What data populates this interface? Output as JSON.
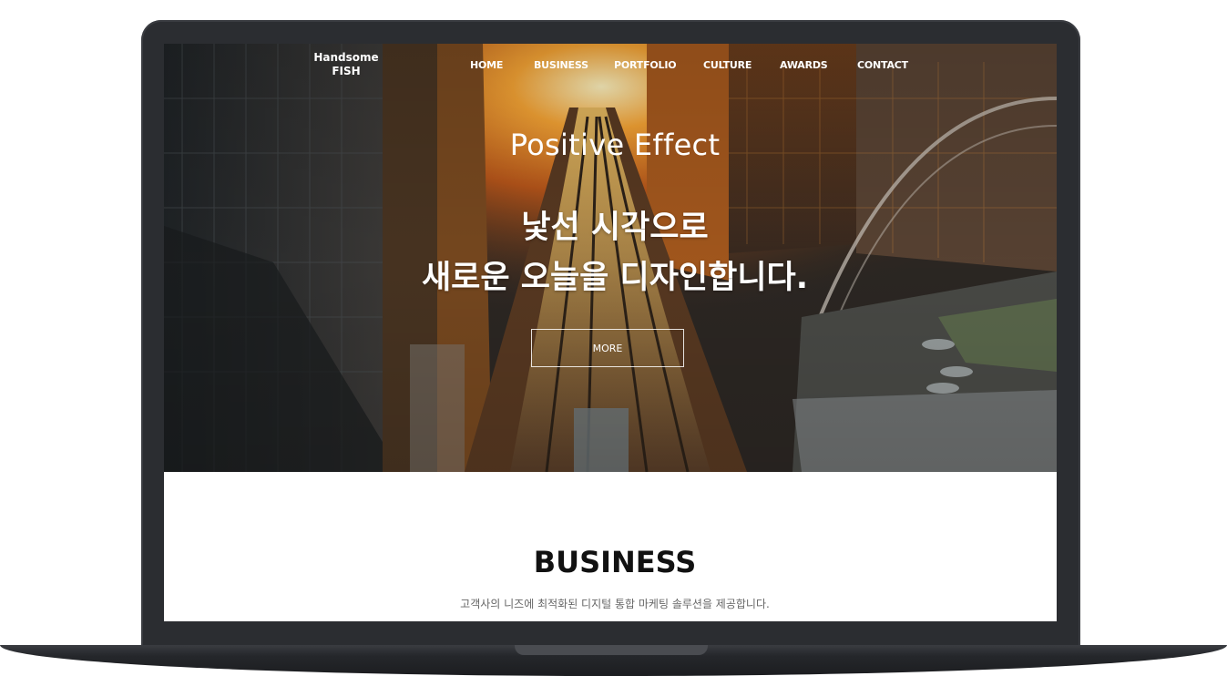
{
  "site": {
    "logo_line1": "Handsome",
    "logo_line2": "FISH"
  },
  "nav": {
    "items": [
      {
        "label": "HOME"
      },
      {
        "label": "BUSINESS"
      },
      {
        "label": "PORTFOLIO"
      },
      {
        "label": "CULTURE"
      },
      {
        "label": "AWARDS"
      },
      {
        "label": "CONTACT"
      }
    ]
  },
  "hero": {
    "subtitle": "Positive Effect",
    "title_line1": "낯선 시각으로",
    "title_line2": "새로운 오늘을 디자인합니다.",
    "button_label": "MORE"
  },
  "business": {
    "title": "BUSINESS",
    "description": "고객사의 니즈에 최적화된 디지털 통합 마케팅 솔루션을 제공합니다."
  },
  "colors": {
    "device_frame": "#2b2d31",
    "hero_glow": "#f28a1e",
    "text_light": "#ffffff",
    "heading_dark": "#111111"
  }
}
